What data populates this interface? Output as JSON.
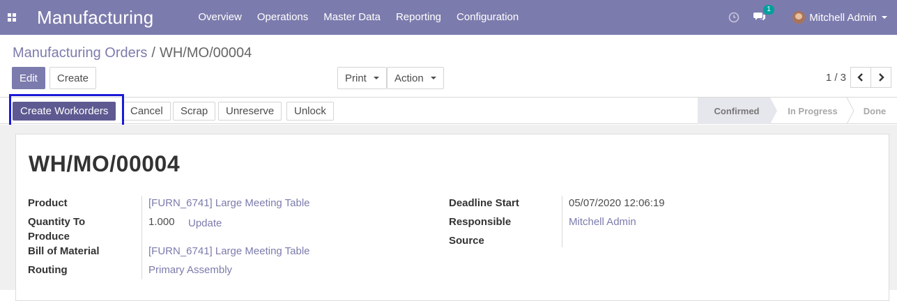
{
  "navbar": {
    "app_name": "Manufacturing",
    "menu": [
      "Overview",
      "Operations",
      "Master Data",
      "Reporting",
      "Configuration"
    ],
    "message_count": "1",
    "user_name": "Mitchell Admin"
  },
  "breadcrumb": {
    "parent": "Manufacturing Orders",
    "separator": "/",
    "current": "WH/MO/00004"
  },
  "buttons": {
    "edit": "Edit",
    "create": "Create",
    "print": "Print",
    "action": "Action"
  },
  "pager": {
    "value": "1 / 3"
  },
  "statusbar": {
    "buttons": {
      "create_workorders": "Create Workorders",
      "cancel": "Cancel",
      "scrap": "Scrap",
      "unreserve": "Unreserve",
      "unlock": "Unlock"
    },
    "steps": [
      "Confirmed",
      "In Progress",
      "Done"
    ],
    "active_step": "Confirmed"
  },
  "form": {
    "title": "WH/MO/00004",
    "product_label": "Product",
    "product_value": "[FURN_6741] Large Meeting Table",
    "qty_label_line1": "Quantity To",
    "qty_label_line2": "Produce",
    "qty_value": "1.000",
    "qty_update": "Update",
    "bom_label": "Bill of Material",
    "bom_value": "[FURN_6741] Large Meeting Table",
    "routing_label": "Routing",
    "routing_value": "Primary Assembly",
    "deadline_label": "Deadline Start",
    "deadline_value": "05/07/2020 12:06:19",
    "responsible_label": "Responsible",
    "responsible_value": "Mitchell Admin",
    "source_label": "Source",
    "source_value": ""
  },
  "colors": {
    "brand": "#7c7bad",
    "primary_dark": "#5e5a91",
    "badge": "#00a09d",
    "highlight": "#1a1ad8"
  }
}
